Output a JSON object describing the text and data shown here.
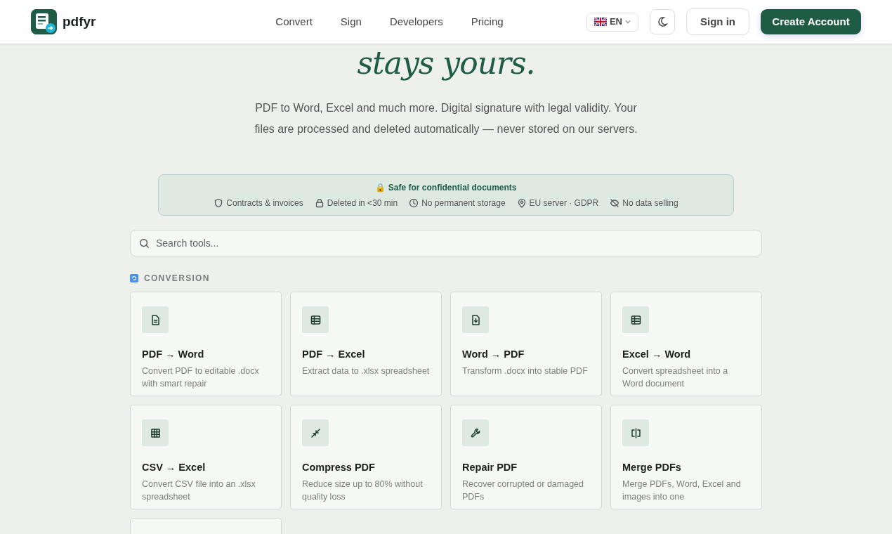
{
  "header": {
    "brand": "pdfyr",
    "nav": [
      "Convert",
      "Sign",
      "Developers",
      "Pricing"
    ],
    "language": "EN",
    "sign_in": "Sign in",
    "create_account": "Create Account"
  },
  "hero": {
    "title": "stays yours.",
    "subtitle": "PDF to Word, Excel and much more. Digital signature with legal validity. Your files are processed and deleted automatically — never stored on our servers."
  },
  "trust": {
    "title": "🔒 Safe for confidential documents",
    "items": [
      {
        "label": "Contracts & invoices"
      },
      {
        "label": "Deleted in <30 min"
      },
      {
        "label": "No permanent storage"
      },
      {
        "label": "EU server · GDPR"
      },
      {
        "label": "No data selling"
      }
    ]
  },
  "search": {
    "placeholder": "Search tools..."
  },
  "section": {
    "title": "CONVERSION"
  },
  "tools": [
    {
      "title": "PDF → Word",
      "description": "Convert PDF to editable .docx with smart repair"
    },
    {
      "title": "PDF → Excel",
      "description": "Extract data to .xlsx spreadsheet"
    },
    {
      "title": "Word → PDF",
      "description": "Transform .docx into stable PDF"
    },
    {
      "title": "Excel → Word",
      "description": "Convert spreadsheet into a Word document"
    },
    {
      "title": "CSV → Excel",
      "description": "Convert CSV file into an .xlsx spreadsheet"
    },
    {
      "title": "Compress PDF",
      "description": "Reduce size up to 80% without quality loss"
    },
    {
      "title": "Repair PDF",
      "description": "Recover corrupted or damaged PDFs"
    },
    {
      "title": "Merge PDFs",
      "description": "Merge PDFs, Word, Excel and images into one"
    }
  ]
}
